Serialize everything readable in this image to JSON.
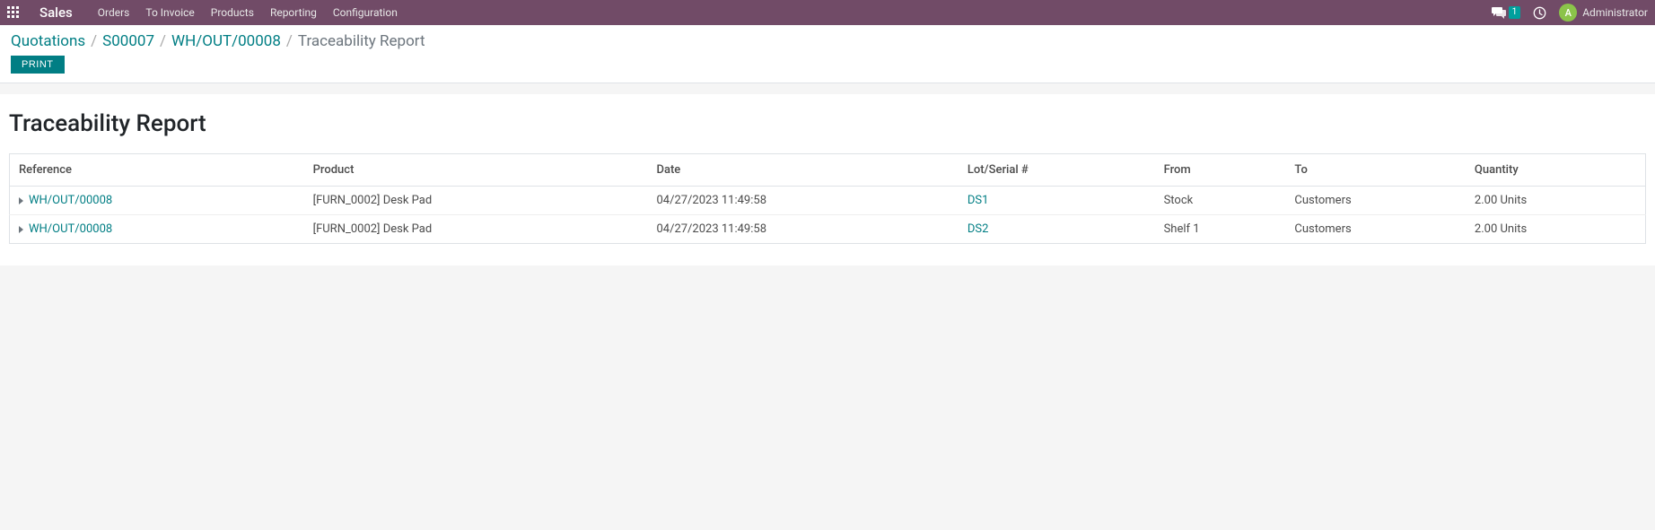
{
  "navbar": {
    "app": "Sales",
    "items": [
      "Orders",
      "To Invoice",
      "Products",
      "Reporting",
      "Configuration"
    ],
    "chat_badge": "1",
    "user_initial": "A",
    "user_name": "Administrator"
  },
  "breadcrumb": {
    "items": [
      "Quotations",
      "S00007",
      "WH/OUT/00008"
    ],
    "current": "Traceability Report"
  },
  "buttons": {
    "print": "PRINT"
  },
  "page_title": "Traceability Report",
  "table": {
    "headers": {
      "reference": "Reference",
      "product": "Product",
      "date": "Date",
      "lot": "Lot/Serial #",
      "from": "From",
      "to": "To",
      "quantity": "Quantity"
    },
    "rows": [
      {
        "reference": "WH/OUT/00008",
        "product": "[FURN_0002] Desk Pad",
        "date": "04/27/2023 11:49:58",
        "lot": "DS1",
        "from": "Stock",
        "to": "Customers",
        "quantity": "2.00 Units"
      },
      {
        "reference": "WH/OUT/00008",
        "product": "[FURN_0002] Desk Pad",
        "date": "04/27/2023 11:49:58",
        "lot": "DS2",
        "from": "Shelf 1",
        "to": "Customers",
        "quantity": "2.00 Units"
      }
    ]
  }
}
